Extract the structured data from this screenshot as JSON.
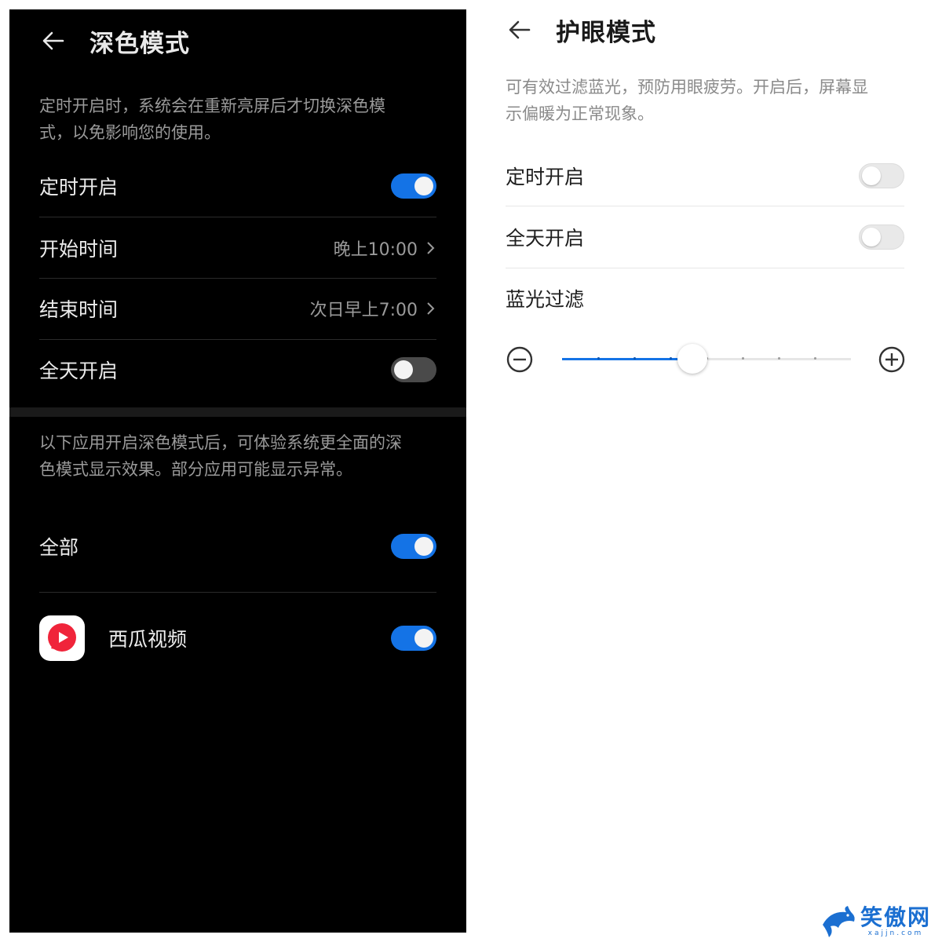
{
  "dark_panel": {
    "title": "深色模式",
    "intro_line1": "定时开启时，系统会在重新亮屏后才切换深色模",
    "intro_line2": "式，以免影响您的使用。",
    "schedule": {
      "label": "定时开启",
      "state": "on"
    },
    "start_time": {
      "label": "开始时间",
      "value": "晚上10:00"
    },
    "end_time": {
      "label": "结束时间",
      "value": "次日早上7:00"
    },
    "all_day": {
      "label": "全天开启",
      "state": "off"
    },
    "apps_desc_line1": "以下应用开启深色模式后，可体验系统更全面的深",
    "apps_desc_line2": "色模式显示效果。部分应用可能显示异常。",
    "all_apps": {
      "label": "全部",
      "state": "on"
    },
    "apps": [
      {
        "name": "西瓜视频",
        "state": "on",
        "icon": "xigua-video-icon"
      }
    ]
  },
  "light_panel": {
    "title": "护眼模式",
    "desc_line1": "可有效过滤蓝光，预防用眼疲劳。开启后，屏幕显",
    "desc_line2": "示偏暖为正常现象。",
    "schedule": {
      "label": "定时开启",
      "state": "off"
    },
    "all_day": {
      "label": "全天开启",
      "state": "off"
    },
    "blue_filter": {
      "label": "蓝光过滤",
      "level": 0.45,
      "steps": 8
    }
  },
  "watermark": {
    "text": "笑傲网",
    "url": "xajjn.com"
  },
  "colors": {
    "accent": "#1473e6",
    "dark_bg": "#000000",
    "light_bg": "#ffffff"
  }
}
